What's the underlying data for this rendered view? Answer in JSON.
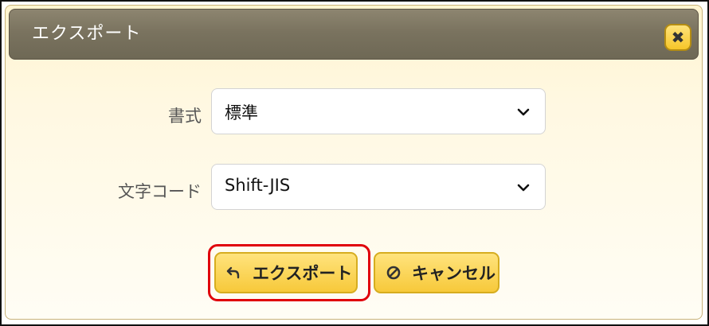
{
  "dialog": {
    "title": "エクスポート"
  },
  "fields": {
    "format": {
      "label": "書式",
      "value": "標準"
    },
    "encoding": {
      "label": "文字コード",
      "value": "Shift-JIS"
    }
  },
  "buttons": {
    "export_label": "エクスポート",
    "cancel_label": "キャンセル"
  },
  "icons": {
    "close": "close-icon",
    "export": "undo-arrow-icon",
    "cancel": "no-entry-icon",
    "dropdown": "chevron-down-icon"
  },
  "colors": {
    "titlebar": "#7a735f",
    "button": "#f7c93a",
    "highlight": "#e0000b"
  }
}
